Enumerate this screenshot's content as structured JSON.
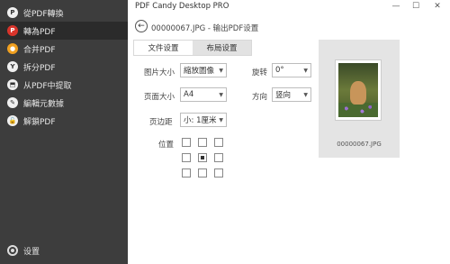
{
  "app": {
    "title": "PDF Candy Desktop PRO"
  },
  "window": {
    "minimize": "—",
    "maximize": "☐",
    "close": "✕"
  },
  "sidebar": {
    "items": [
      {
        "label": "從PDF轉換",
        "icon": "pdf-icon"
      },
      {
        "label": "轉為PDF",
        "icon": "pdf-icon"
      },
      {
        "label": "合并PDF",
        "icon": "merge-icon"
      },
      {
        "label": "拆分PDF",
        "icon": "split-icon"
      },
      {
        "label": "从PDF中提取",
        "icon": "extract-icon"
      },
      {
        "label": "編輯元數據",
        "icon": "metadata-icon"
      },
      {
        "label": "解鎖PDF",
        "icon": "unlock-icon"
      }
    ],
    "settings_label": "设置"
  },
  "header": {
    "back": "←",
    "breadcrumb": "00000067.JPG - 输出PDF设置"
  },
  "tabs": [
    {
      "label": "文件设置"
    },
    {
      "label": "布局设置"
    }
  ],
  "form": {
    "image_size": {
      "label": "图片大小",
      "value": "縮放圖像"
    },
    "rotation": {
      "label": "旋转",
      "value": "0°"
    },
    "page_size": {
      "label": "页面大小",
      "value": "A4"
    },
    "orientation": {
      "label": "方向",
      "value": "竖向"
    },
    "margin": {
      "label": "页边距",
      "value": "小: 1厘米"
    },
    "position": {
      "label": "位置",
      "selected": "middle-center"
    }
  },
  "preview": {
    "filename": "00000067.JPG"
  },
  "colors": {
    "sidebar_bg": "#3d3d3d",
    "sidebar_active": "#2b2b2b",
    "accent_orange": "#f0a020",
    "accent_red": "#d9342b"
  }
}
